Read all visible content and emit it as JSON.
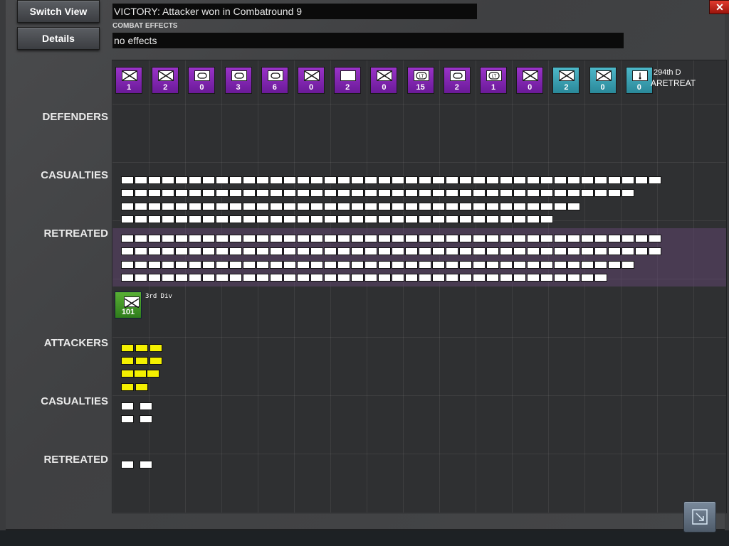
{
  "buttons": {
    "switch_view": "Switch View",
    "details": "Details",
    "close": "✕"
  },
  "result": "VICTORY: Attacker won in Combatround  9",
  "effects": {
    "label": "COMBAT EFFECTS",
    "value": "no effects"
  },
  "rows": {
    "defenders": "DEFENDERS",
    "def_casualties": "CASUALTIES",
    "def_retreated": "RETREATED",
    "attackers": "ATTACKERS",
    "att_casualties": "CASUALTIES",
    "att_retreated": "RETREATED"
  },
  "defender_units": [
    {
      "count": "1",
      "color": "purple",
      "icon": "infantry-icon"
    },
    {
      "count": "2",
      "color": "purple",
      "icon": "infantry-icon"
    },
    {
      "count": "0",
      "color": "purple",
      "icon": "armor-icon"
    },
    {
      "count": "3",
      "color": "purple",
      "icon": "armor-icon"
    },
    {
      "count": "6",
      "color": "purple",
      "icon": "armor-icon"
    },
    {
      "count": "0",
      "color": "purple",
      "icon": "infantry-icon"
    },
    {
      "count": "2",
      "color": "purple",
      "icon": "blank-icon"
    },
    {
      "count": "0",
      "color": "purple",
      "icon": "infantry-icon"
    },
    {
      "count": "15",
      "color": "purple",
      "icon": "light-tank-icon"
    },
    {
      "count": "2",
      "color": "purple",
      "icon": "armor-icon"
    },
    {
      "count": "1",
      "color": "purple",
      "icon": "light-tank-icon"
    },
    {
      "count": "0",
      "color": "purple",
      "icon": "infantry-icon"
    },
    {
      "count": "2",
      "color": "teal",
      "icon": "infantry-icon"
    },
    {
      "count": "0",
      "color": "teal",
      "icon": "infantry-icon"
    },
    {
      "count": "0",
      "color": "teal",
      "icon": "artillery-icon"
    }
  ],
  "last_unit": {
    "name": "294th D",
    "status": "ARETREAT"
  },
  "attacker_unit": {
    "count": "101",
    "name": "3rd Div",
    "icon": "infantry-icon"
  }
}
